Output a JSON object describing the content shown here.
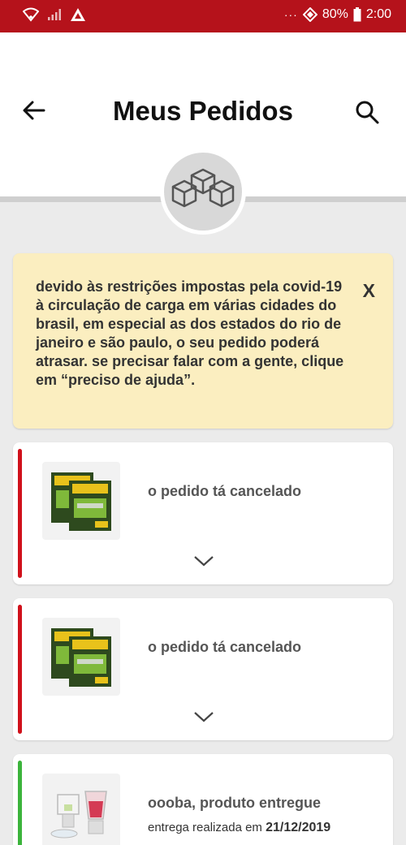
{
  "status_bar": {
    "battery": "80%",
    "time": "2:00",
    "icons": [
      "wifi-icon",
      "signal-icon",
      "app-icon",
      "more-dots-icon",
      "sync-icon",
      "battery-icon"
    ]
  },
  "header": {
    "title": "Meus Pedidos",
    "icons": [
      "back-arrow-icon",
      "search-icon",
      "boxes-icon"
    ]
  },
  "notice": {
    "text": "devido às restrições impostas pela covid-19 à circulação de carga em várias cidades do brasil, em especial as dos estados do rio de janeiro e são paulo, o seu pedido poderá atrasar. se precisar falar com a gente, clique em “preciso de ajuda”.",
    "close_label": "X",
    "bg_color": "#fbeec0"
  },
  "orders": [
    {
      "status": "o pedido tá cancelado",
      "status_color": "#d0111b",
      "product_icon": "razor-blades-product"
    },
    {
      "status": "o pedido tá cancelado",
      "status_color": "#d0111b",
      "product_icon": "razor-blades-product"
    },
    {
      "status": "oooba, produto entregue",
      "status_color": "#3cb43c",
      "product_icon": "blender-product",
      "delivery_label": "entrega realizada em",
      "delivery_date": "21/12/2019"
    }
  ],
  "colors": {
    "brand": "#b5121b"
  }
}
